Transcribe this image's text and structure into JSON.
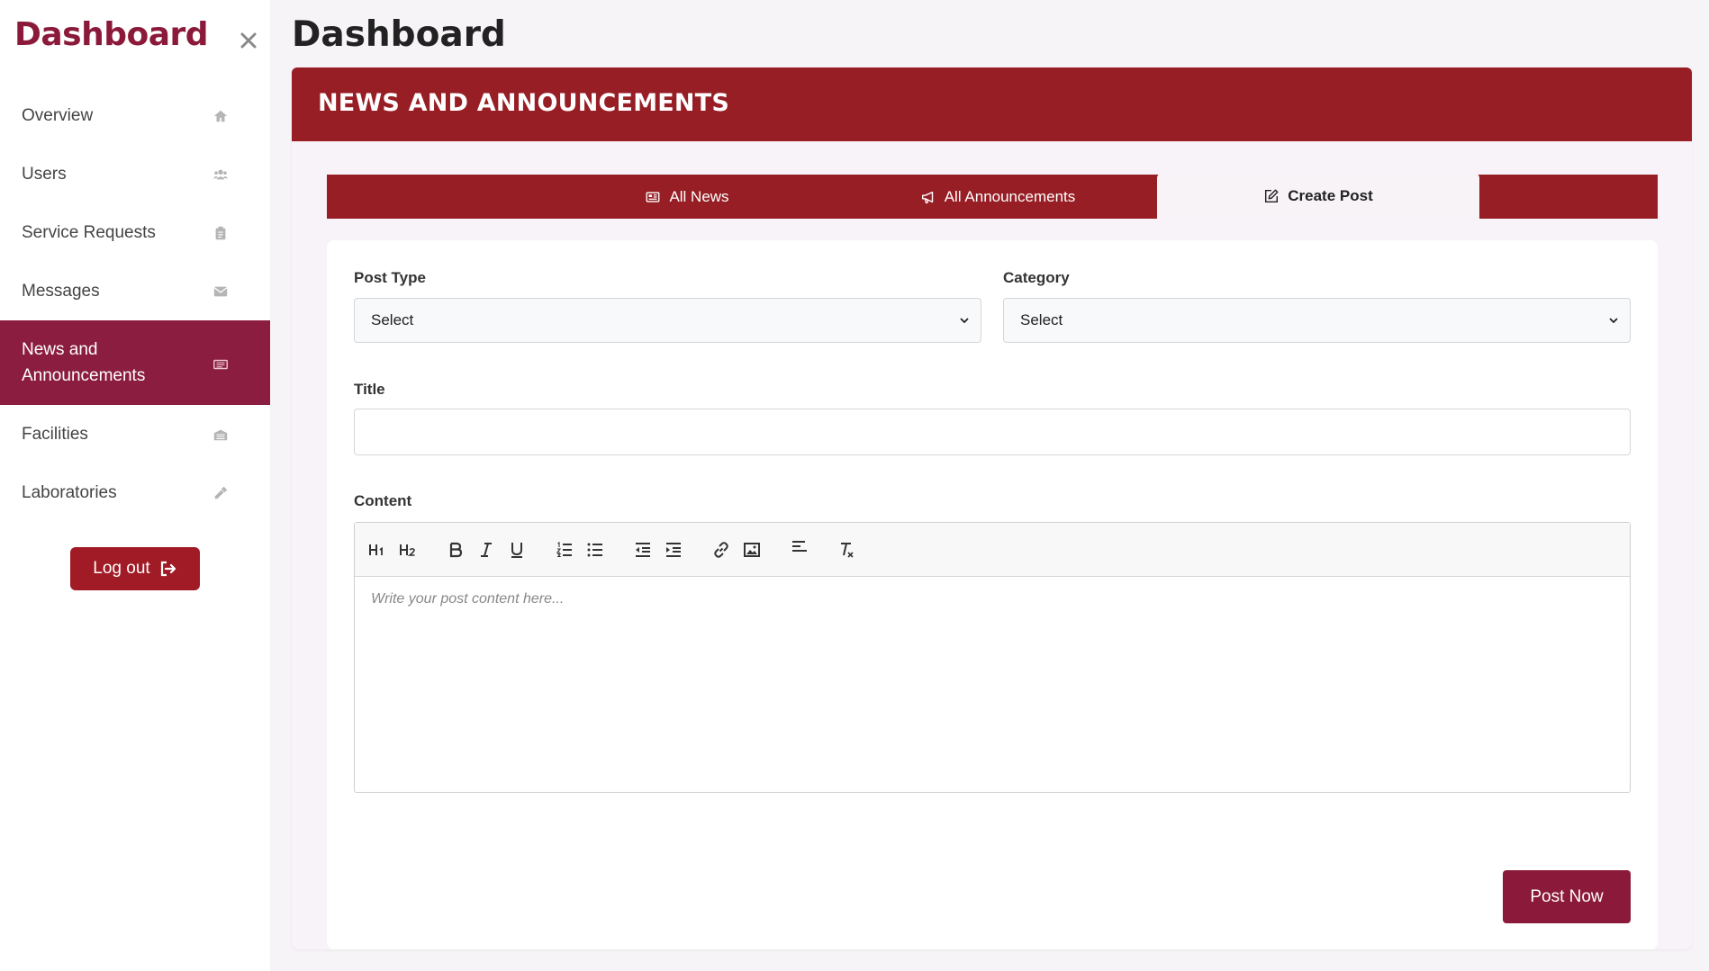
{
  "sidebar": {
    "brand": "Dashboard",
    "close_icon": "close-icon",
    "items": [
      {
        "label": "Overview",
        "icon": "home-icon"
      },
      {
        "label": "Users",
        "icon": "users-icon"
      },
      {
        "label": "Service Requests",
        "icon": "clipboard-icon"
      },
      {
        "label": "Messages",
        "icon": "envelope-icon"
      },
      {
        "label": "News and Announcements",
        "icon": "newspaper-icon",
        "active": true
      },
      {
        "label": "Facilities",
        "icon": "building-icon"
      },
      {
        "label": "Laboratories",
        "icon": "eyedropper-icon"
      }
    ],
    "logout_label": "Log out",
    "logout_icon": "sign-out-icon"
  },
  "main": {
    "page_title": "Dashboard",
    "panel_title": "NEWS AND ANNOUNCEMENTS",
    "tabs": [
      {
        "label": "All News",
        "icon": "newspaper-icon"
      },
      {
        "label": "All Announcements",
        "icon": "megaphone-icon"
      },
      {
        "label": "Create Post",
        "icon": "edit-icon",
        "active": true
      }
    ],
    "form": {
      "post_type_label": "Post Type",
      "post_type_value": "Select",
      "category_label": "Category",
      "category_value": "Select",
      "title_label": "Title",
      "title_value": "",
      "content_label": "Content",
      "content_placeholder": "Write your post content here...",
      "toolbar": [
        "header-1",
        "header-2",
        "bold",
        "italic",
        "underline",
        "ordered-list",
        "bullet-list",
        "outdent",
        "indent",
        "link",
        "image",
        "align",
        "clear-format"
      ],
      "submit_label": "Post Now"
    }
  },
  "colors": {
    "brand": "#8b1a3a",
    "header_red": "#961e24",
    "active_nav": "#8b1d40",
    "logout_red": "#a11b26"
  }
}
